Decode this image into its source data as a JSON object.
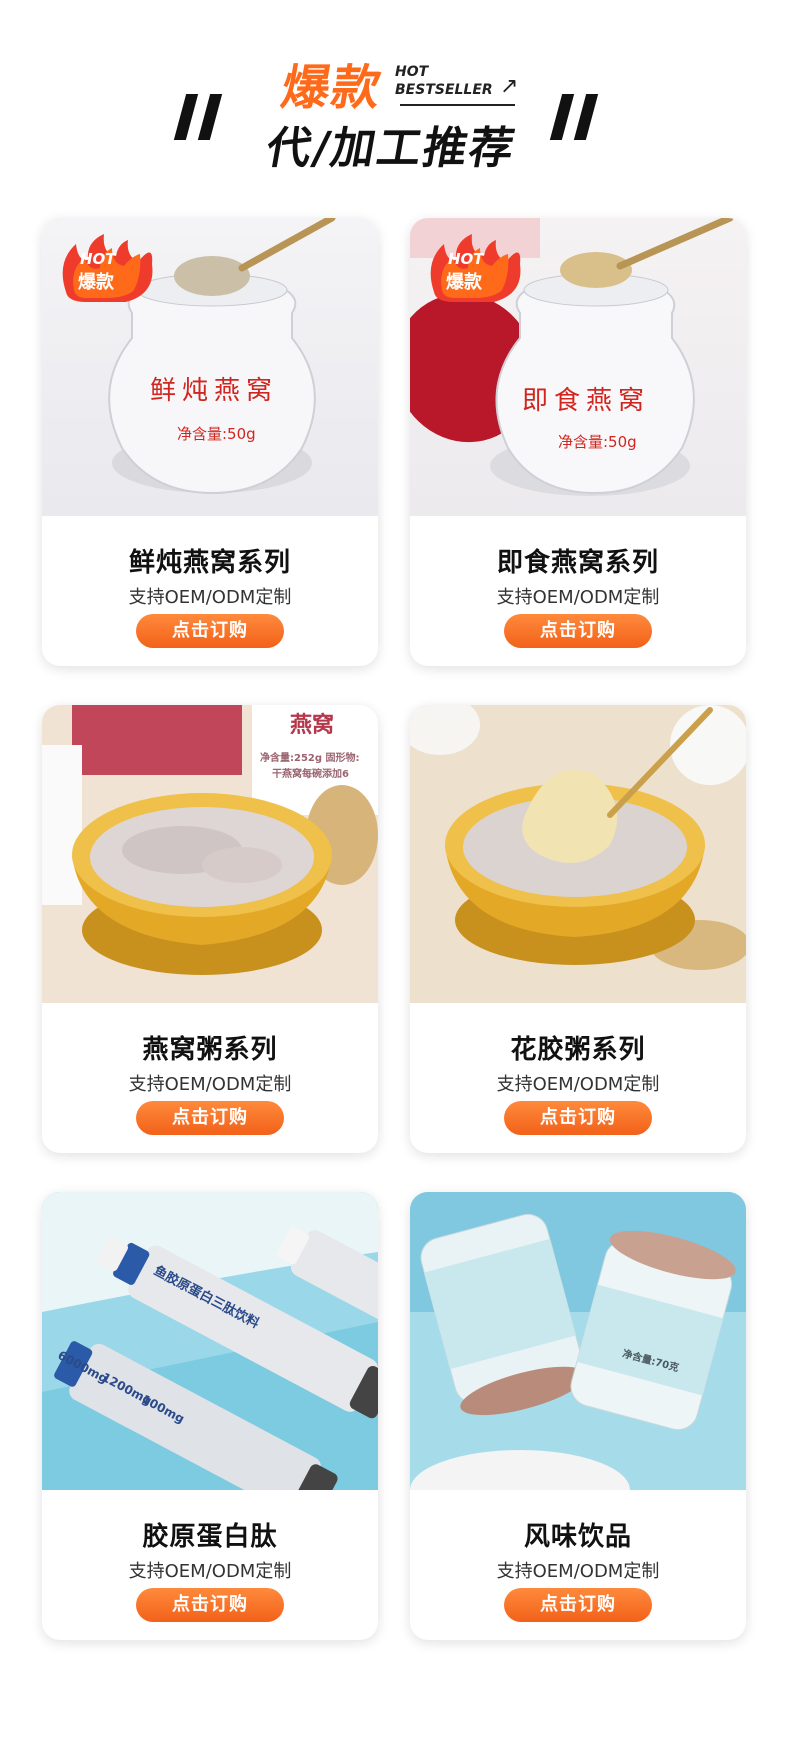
{
  "header": {
    "hot_word": "爆款",
    "hot_en_line1": "HOT",
    "hot_en_line2": "BESTSELLER",
    "subtitle": "代/加工推荐"
  },
  "badge": {
    "line1": "HOT",
    "line2": "爆款"
  },
  "products": [
    {
      "name": "鲜炖燕窝系列",
      "desc": "支持OEM/ODM定制",
      "button": "点击订购",
      "jar_label": "鲜炖燕窝",
      "net": "净含量:50g",
      "has_badge": true
    },
    {
      "name": "即食燕窝系列",
      "desc": "支持OEM/ODM定制",
      "button": "点击订购",
      "jar_label": "即食燕窝",
      "net": "净含量:50g",
      "has_badge": true
    },
    {
      "name": "燕窝粥系列",
      "desc": "支持OEM/ODM定制",
      "button": "点击订购",
      "box_label": "燕窝",
      "box_net": "净含量:252g 固形物:",
      "box_note": "干燕窝每碗添加6",
      "has_badge": false
    },
    {
      "name": "花胶粥系列",
      "desc": "支持OEM/ODM定制",
      "button": "点击订购",
      "has_badge": false
    },
    {
      "name": "胶原蛋白肽",
      "desc": "支持OEM/ODM定制",
      "button": "点击订购",
      "vial_text": "鱼胶原蛋白三肽饮料",
      "vial_num1": "6000mg",
      "vial_num2": "1200mg",
      "vial_num3": "100mg",
      "has_badge": false
    },
    {
      "name": "风味饮品",
      "desc": "支持OEM/ODM定制",
      "button": "点击订购",
      "jar_net": "净含量:70克",
      "has_badge": false
    }
  ],
  "colors": {
    "accent": "#ff6a1a",
    "button": "#f2611a",
    "jar_text": "#d0261f"
  }
}
